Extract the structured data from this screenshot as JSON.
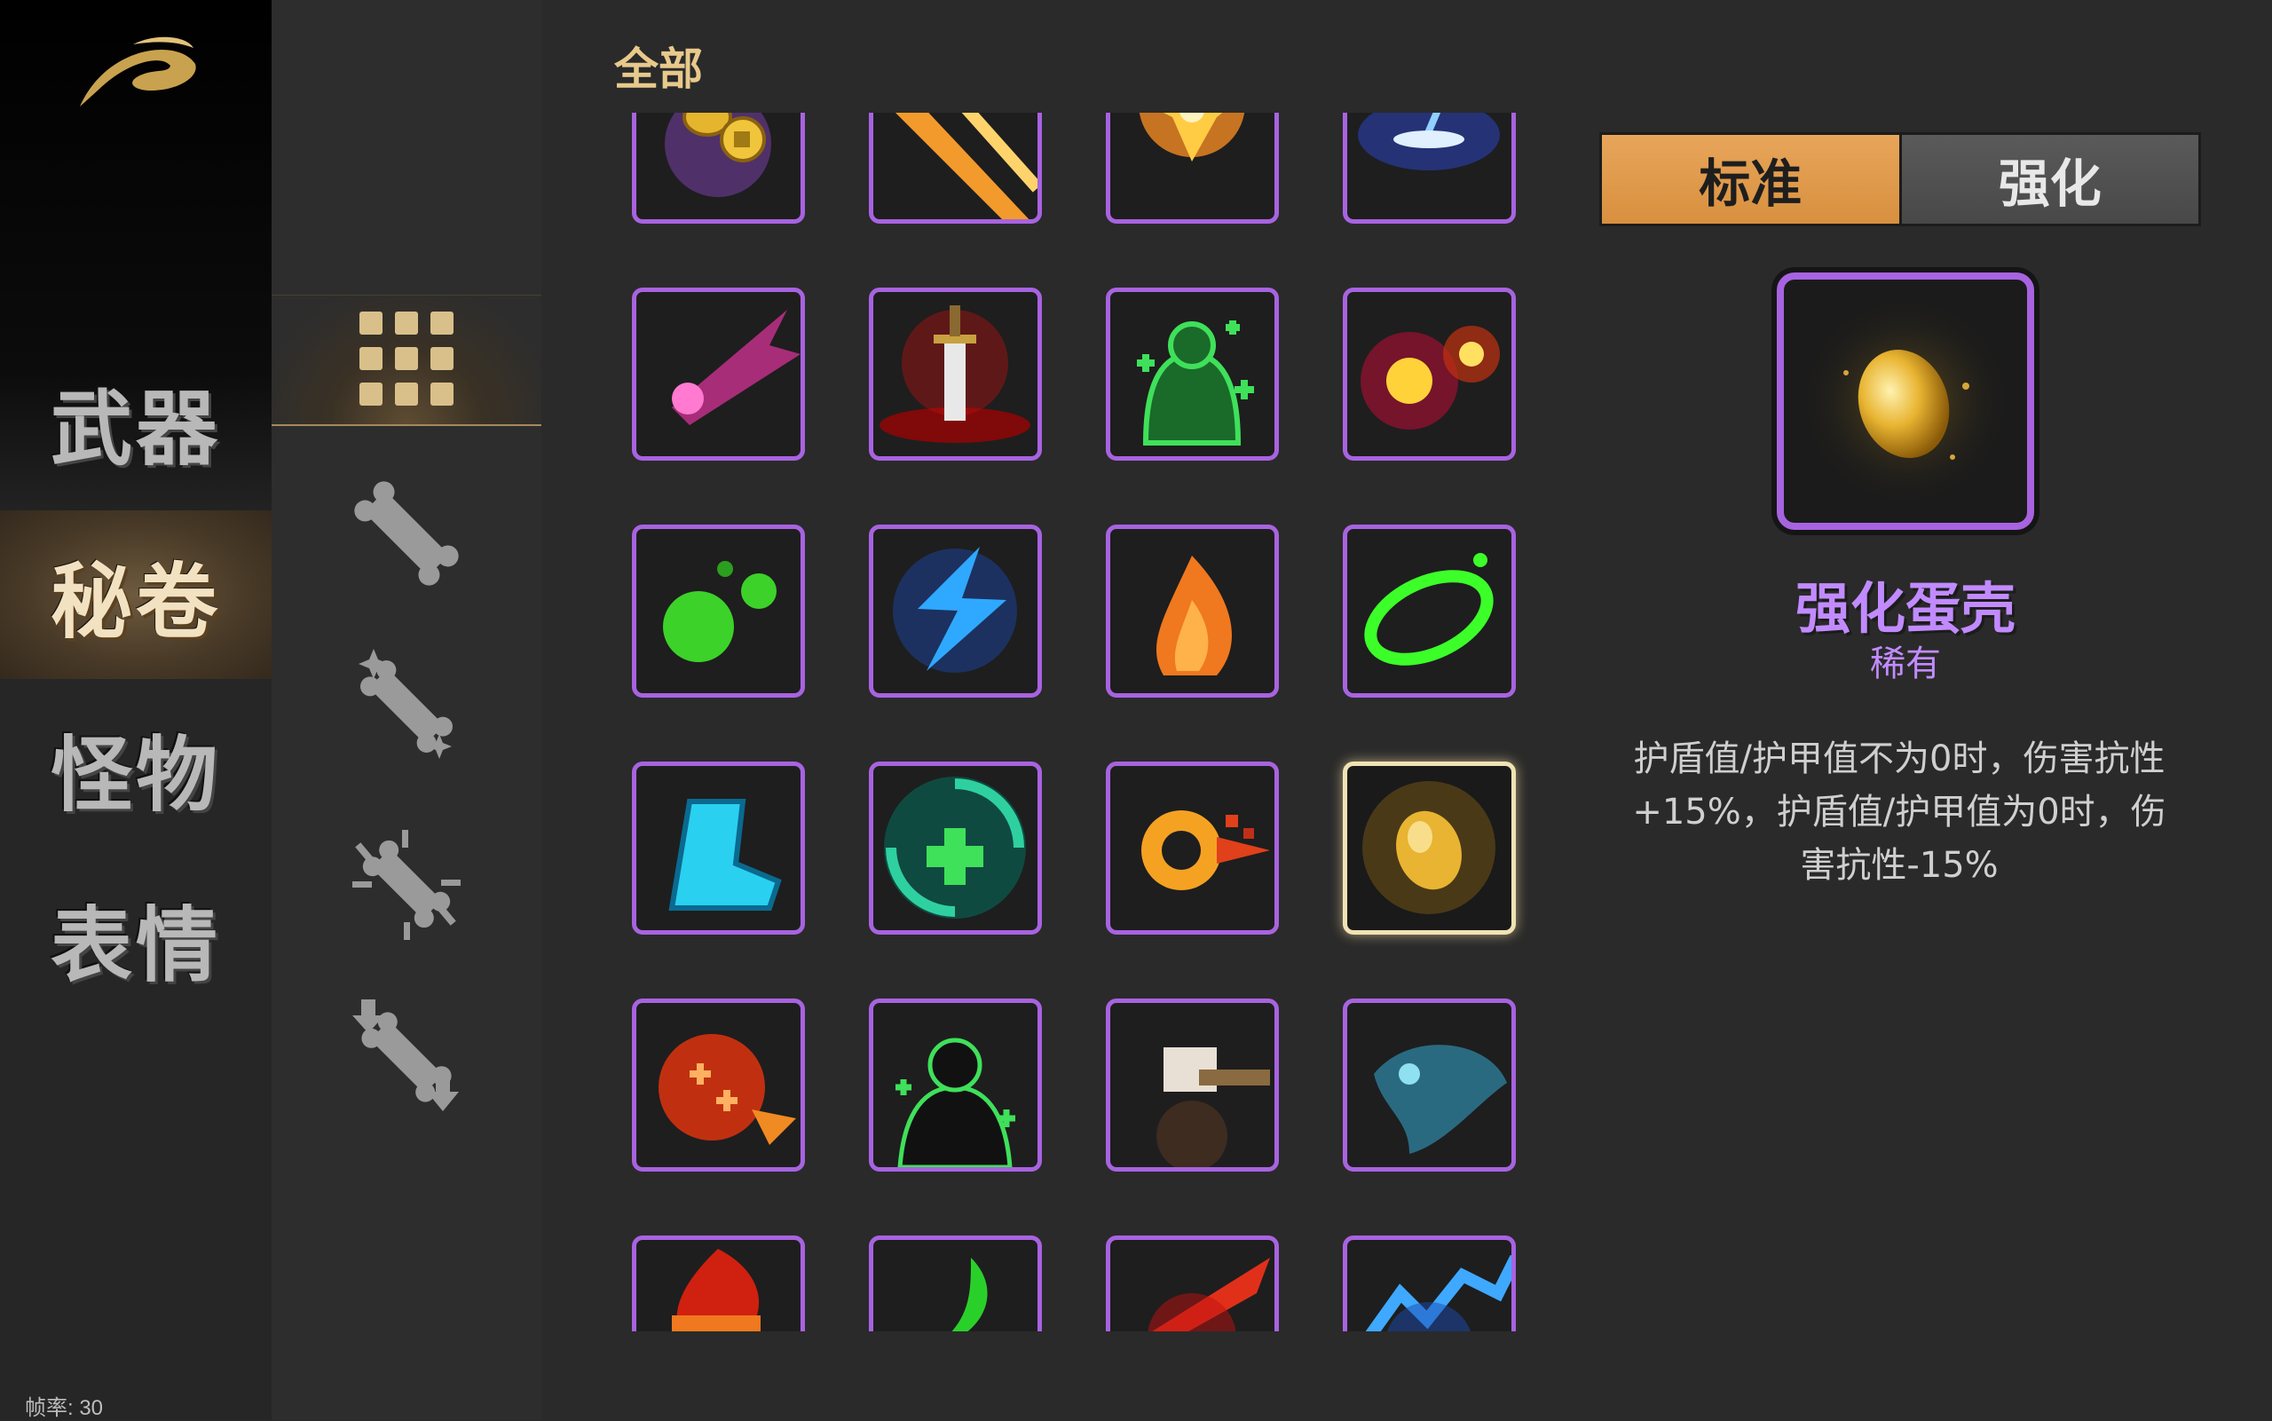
{
  "sidebar": {
    "logo": "brush-logo-icon",
    "categories": [
      {
        "label": "武器",
        "active": false
      },
      {
        "label": "秘卷",
        "active": true
      },
      {
        "label": "怪物",
        "active": false
      },
      {
        "label": "表情",
        "active": false
      }
    ],
    "fps_text": "帧率: 30"
  },
  "filters": [
    {
      "icon": "grid-all-icon",
      "active": true
    },
    {
      "icon": "scroll-icon",
      "active": false
    },
    {
      "icon": "scroll-sparkle-icon",
      "active": false
    },
    {
      "icon": "scroll-burst-icon",
      "active": false
    },
    {
      "icon": "scroll-arrows-icon",
      "active": false
    }
  ],
  "grid": {
    "header": "全部",
    "items": [
      {
        "icon": "gold-coins-icon"
      },
      {
        "icon": "fire-slash-icon"
      },
      {
        "icon": "fire-explosion-icon"
      },
      {
        "icon": "lightning-strike-icon"
      },
      {
        "icon": "pink-dash-icon"
      },
      {
        "icon": "blood-sword-icon"
      },
      {
        "icon": "green-heal-aura-icon"
      },
      {
        "icon": "double-explosion-icon"
      },
      {
        "icon": "green-slime-icon"
      },
      {
        "icon": "blue-lightning-icon"
      },
      {
        "icon": "orange-flame-icon"
      },
      {
        "icon": "green-ring-icon"
      },
      {
        "icon": "cyan-boot-icon"
      },
      {
        "icon": "heal-vortex-icon"
      },
      {
        "icon": "fire-swirl-icon"
      },
      {
        "icon": "golden-egg-icon",
        "selected": true
      },
      {
        "icon": "red-debuff-icon"
      },
      {
        "icon": "heal-silhouette-icon"
      },
      {
        "icon": "hammer-icon"
      },
      {
        "icon": "ghost-wing-icon"
      },
      {
        "icon": "red-fire-icon"
      },
      {
        "icon": "green-claw-icon"
      },
      {
        "icon": "red-slash-icon"
      },
      {
        "icon": "blue-shock-icon"
      }
    ]
  },
  "detail": {
    "toggle": {
      "standard": "标准",
      "enhanced": "强化",
      "active": "standard"
    },
    "icon": "golden-egg-icon",
    "name": "强化蛋壳",
    "rarity": "稀有",
    "description": "护盾值/护甲值不为0时，伤害抗性+15%，护盾值/护甲值为0时，伤害抗性-15%",
    "colors": {
      "rarity": "#c18bff",
      "border": "#a863e0",
      "toggle_on": "#e0a050"
    }
  }
}
